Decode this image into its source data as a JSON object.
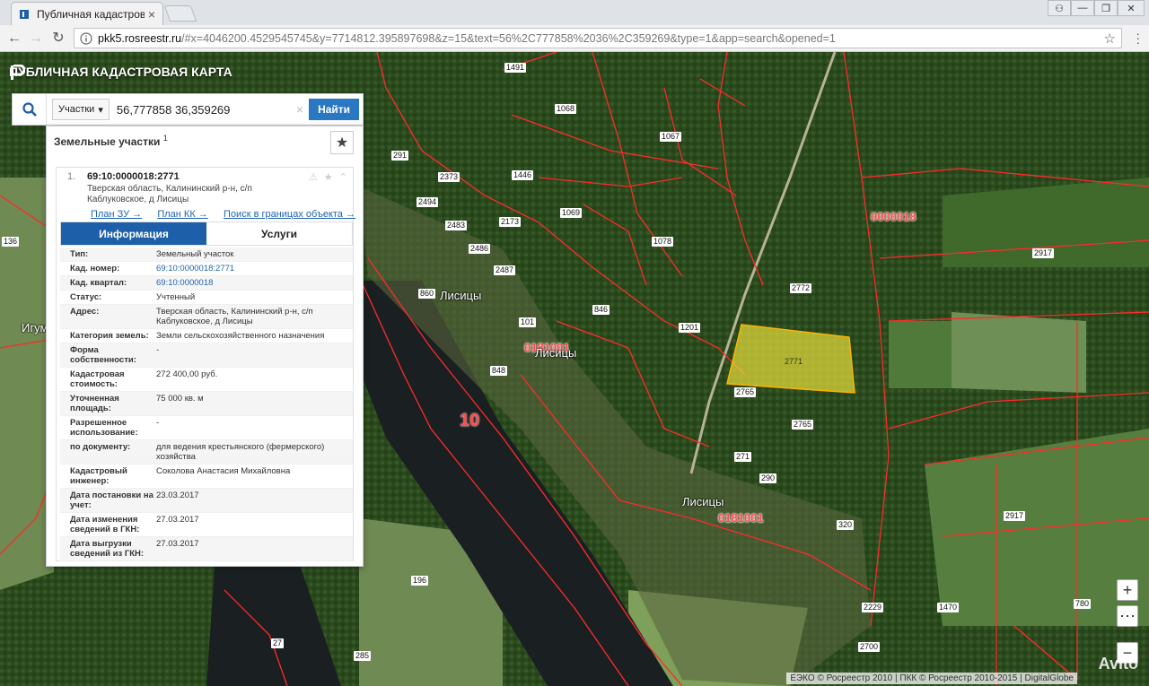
{
  "browser": {
    "tab_title": "Публичная кадастровая",
    "tab_close": "×",
    "url_host": "pkk5.rosreestr.ru",
    "url_rest": "/#x=4046200.4529545745&y=7714812.395897698&z=15&text=56%2C777858%2036%2C359269&type=1&app=search&opened=1",
    "window_controls": [
      "⚇",
      "—",
      "❐",
      "✕"
    ],
    "back_icon": "←",
    "forward_icon": "→",
    "reload_icon": "↻",
    "star_icon": "☆"
  },
  "map": {
    "header_title": "ПУБЛИЧНАЯ КАДАСТРОВАЯ КАРТА",
    "attribution": "ЕЭКО © Росреестр 2010 | ПКК © Росреестр 2010-2015 | DigitalGlobe",
    "watermark": "Avito",
    "zoom_in": "+",
    "zoom_out": "−",
    "zoom_more": "⋯",
    "river_label": "10",
    "kv_labels": [
      "0000018",
      "0181001",
      "0181001"
    ],
    "place_labels": [
      "Лисицы",
      "Лисицы",
      "Лисицы",
      "Игум"
    ],
    "parcel_labels": [
      "1068",
      "1067",
      "2373",
      "1069",
      "1078",
      "2772",
      "2917",
      "846",
      "1201",
      "2771",
      "2765",
      "2765",
      "860",
      "2917",
      "196",
      "285",
      "780",
      "1470",
      "2700",
      "2229",
      "1446",
      "2494",
      "2483",
      "2486",
      "2487",
      "2173",
      "1491",
      "291",
      "27",
      "136",
      "271",
      "290",
      "320",
      "101",
      "848"
    ],
    "colors": {
      "highlight": "#e8e03a",
      "boundary": "#ff2a2a"
    }
  },
  "search": {
    "type_label": "Участки",
    "query": "56,777858 36,359269",
    "clear_icon": "×",
    "button_label": "Найти"
  },
  "results": {
    "title": "Земельные участки",
    "count": "1",
    "favorite_icon": "★",
    "item": {
      "num": "1.",
      "cad_number": "69:10:0000018:2771",
      "address": "Тверская область, Калининский р-н, с/п Каблуковское, д Лисицы",
      "icons": "⚠ ★ ⌃",
      "links": [
        "План ЗУ →",
        "План КК →",
        "Поиск в границах объекта →"
      ],
      "tabs": [
        "Информация",
        "Услуги"
      ]
    },
    "attributes": [
      {
        "k": "Тип:",
        "v": "Земельный участок"
      },
      {
        "k": "Кад. номер:",
        "v": "69:10:0000018:2771"
      },
      {
        "k": "Кад. квартал:",
        "v": "69:10:0000018"
      },
      {
        "k": "Статус:",
        "v": "Учтенный"
      },
      {
        "k": "Адрес:",
        "v": "Тверская область, Калининский р-н, с/п Каблуковское, д Лисицы"
      },
      {
        "k": "Категория земель:",
        "v": "Земли сельскохозяйственного назначения"
      },
      {
        "k": "Форма собственности:",
        "v": "-"
      },
      {
        "k": "Кадастровая стоимость:",
        "v": "272 400,00 руб."
      },
      {
        "k": "Уточненная площадь:",
        "v": "75 000 кв. м"
      },
      {
        "k": "Разрешенное использование:",
        "v": "-"
      },
      {
        "k": "по документу:",
        "v": "для ведения крестьянского (фермерского) хозяйства"
      },
      {
        "k": "Кадастровый инженер:",
        "v": "Соколова Анастасия Михайловна"
      },
      {
        "k": "Дата постановки на учет:",
        "v": "23.03.2017"
      },
      {
        "k": "Дата изменения сведений в ГКН:",
        "v": "27.03.2017"
      },
      {
        "k": "Дата выгрузки сведений из ГКН:",
        "v": "27.03.2017"
      }
    ]
  }
}
